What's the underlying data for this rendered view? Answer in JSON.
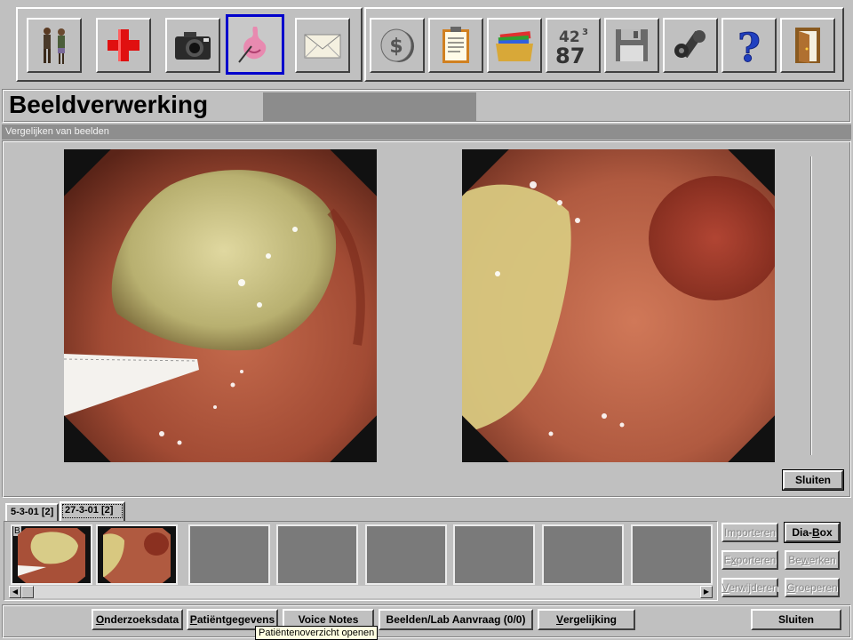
{
  "toolbar": {
    "group1": [
      {
        "name": "patients",
        "icon": "people-icon"
      },
      {
        "name": "medical",
        "icon": "red-cross-icon"
      },
      {
        "name": "camera",
        "icon": "camera-icon"
      },
      {
        "name": "endoscopy",
        "icon": "stomach-icon",
        "selected": true
      },
      {
        "name": "mail",
        "icon": "envelope-icon"
      }
    ],
    "group2": [
      {
        "name": "billing",
        "icon": "coin-icon"
      },
      {
        "name": "notes",
        "icon": "clipboard-icon"
      },
      {
        "name": "files",
        "icon": "folder-icon"
      },
      {
        "name": "numbers",
        "icon": "numbers-icon",
        "text_top": "42",
        "text_sup": "3",
        "text_bottom": "87"
      },
      {
        "name": "save",
        "icon": "floppy-icon"
      },
      {
        "name": "settings",
        "icon": "wrench-icon"
      },
      {
        "name": "help",
        "icon": "question-icon",
        "glyph": "?"
      },
      {
        "name": "exit",
        "icon": "door-icon"
      }
    ]
  },
  "header": {
    "title": "Beeldverwerking",
    "section": "Vergelijken van beelden"
  },
  "compare": {
    "close_label": "Sluiten"
  },
  "tabs": [
    {
      "label": "5-3-01 [2]",
      "active": false
    },
    {
      "label": "27-3-01  [2]",
      "active": true
    }
  ],
  "thumbnails": {
    "count_filled": 2,
    "count_empty": 6,
    "first_overlay_letter": "B"
  },
  "side_buttons": {
    "import": {
      "label": "Importeren",
      "enabled": false
    },
    "dia_box": {
      "pre": "Dia-",
      "accel": "B",
      "post": "ox",
      "enabled": true
    },
    "export": {
      "pre": "E",
      "accel": "x",
      "post": "porteren",
      "enabled": false
    },
    "edit": {
      "pre": "Be",
      "accel": "w",
      "post": "erken",
      "enabled": false
    },
    "delete": {
      "pre": "",
      "accel": "V",
      "post": "erwijderen",
      "enabled": false
    },
    "group": {
      "pre": "",
      "accel": "G",
      "post": "roeperen",
      "enabled": false
    }
  },
  "bottom_bar": {
    "exam_data": {
      "pre": "",
      "accel": "O",
      "post": "nderzoeksdata"
    },
    "patient_data": {
      "pre": "",
      "accel": "P",
      "post": "atiëntgegevens"
    },
    "voice_notes": "Voice Notes",
    "images_lab": "Beelden/Lab Aanvraag (0/0)",
    "compare": {
      "pre": "",
      "accel": "V",
      "post": "ergelijking"
    },
    "close": "Sluiten"
  },
  "tooltip": "Patiëntenoverzicht openen",
  "colors": {
    "selected_border": "#0000cc",
    "panel_gray": "#c0c0c0",
    "strip_gray": "#8e8e8e"
  }
}
